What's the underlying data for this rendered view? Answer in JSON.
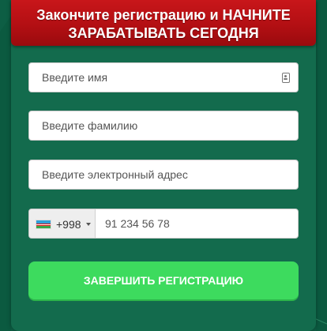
{
  "header": {
    "line1": "Закончите регистрацию и НАЧНИТЕ",
    "line2": "ЗАРАБАТЫВАТЬ СЕГОДНЯ"
  },
  "form": {
    "first_name_placeholder": "Введите имя",
    "last_name_placeholder": "Введите фамилию",
    "email_placeholder": "Введите электронный адрес",
    "phone": {
      "country_code": "+998",
      "placeholder": "91 234 56 78"
    },
    "submit_label": "ЗАВЕРШИТЬ РЕГИСТРАЦИЮ"
  },
  "colors": {
    "background": "#0d5e44",
    "card": "#136b4d",
    "banner": "#c8161a",
    "submit": "#3ddb5e"
  },
  "icons": [
    "contact-card-icon",
    "uzbekistan-flag-icon",
    "chevron-down-icon"
  ]
}
